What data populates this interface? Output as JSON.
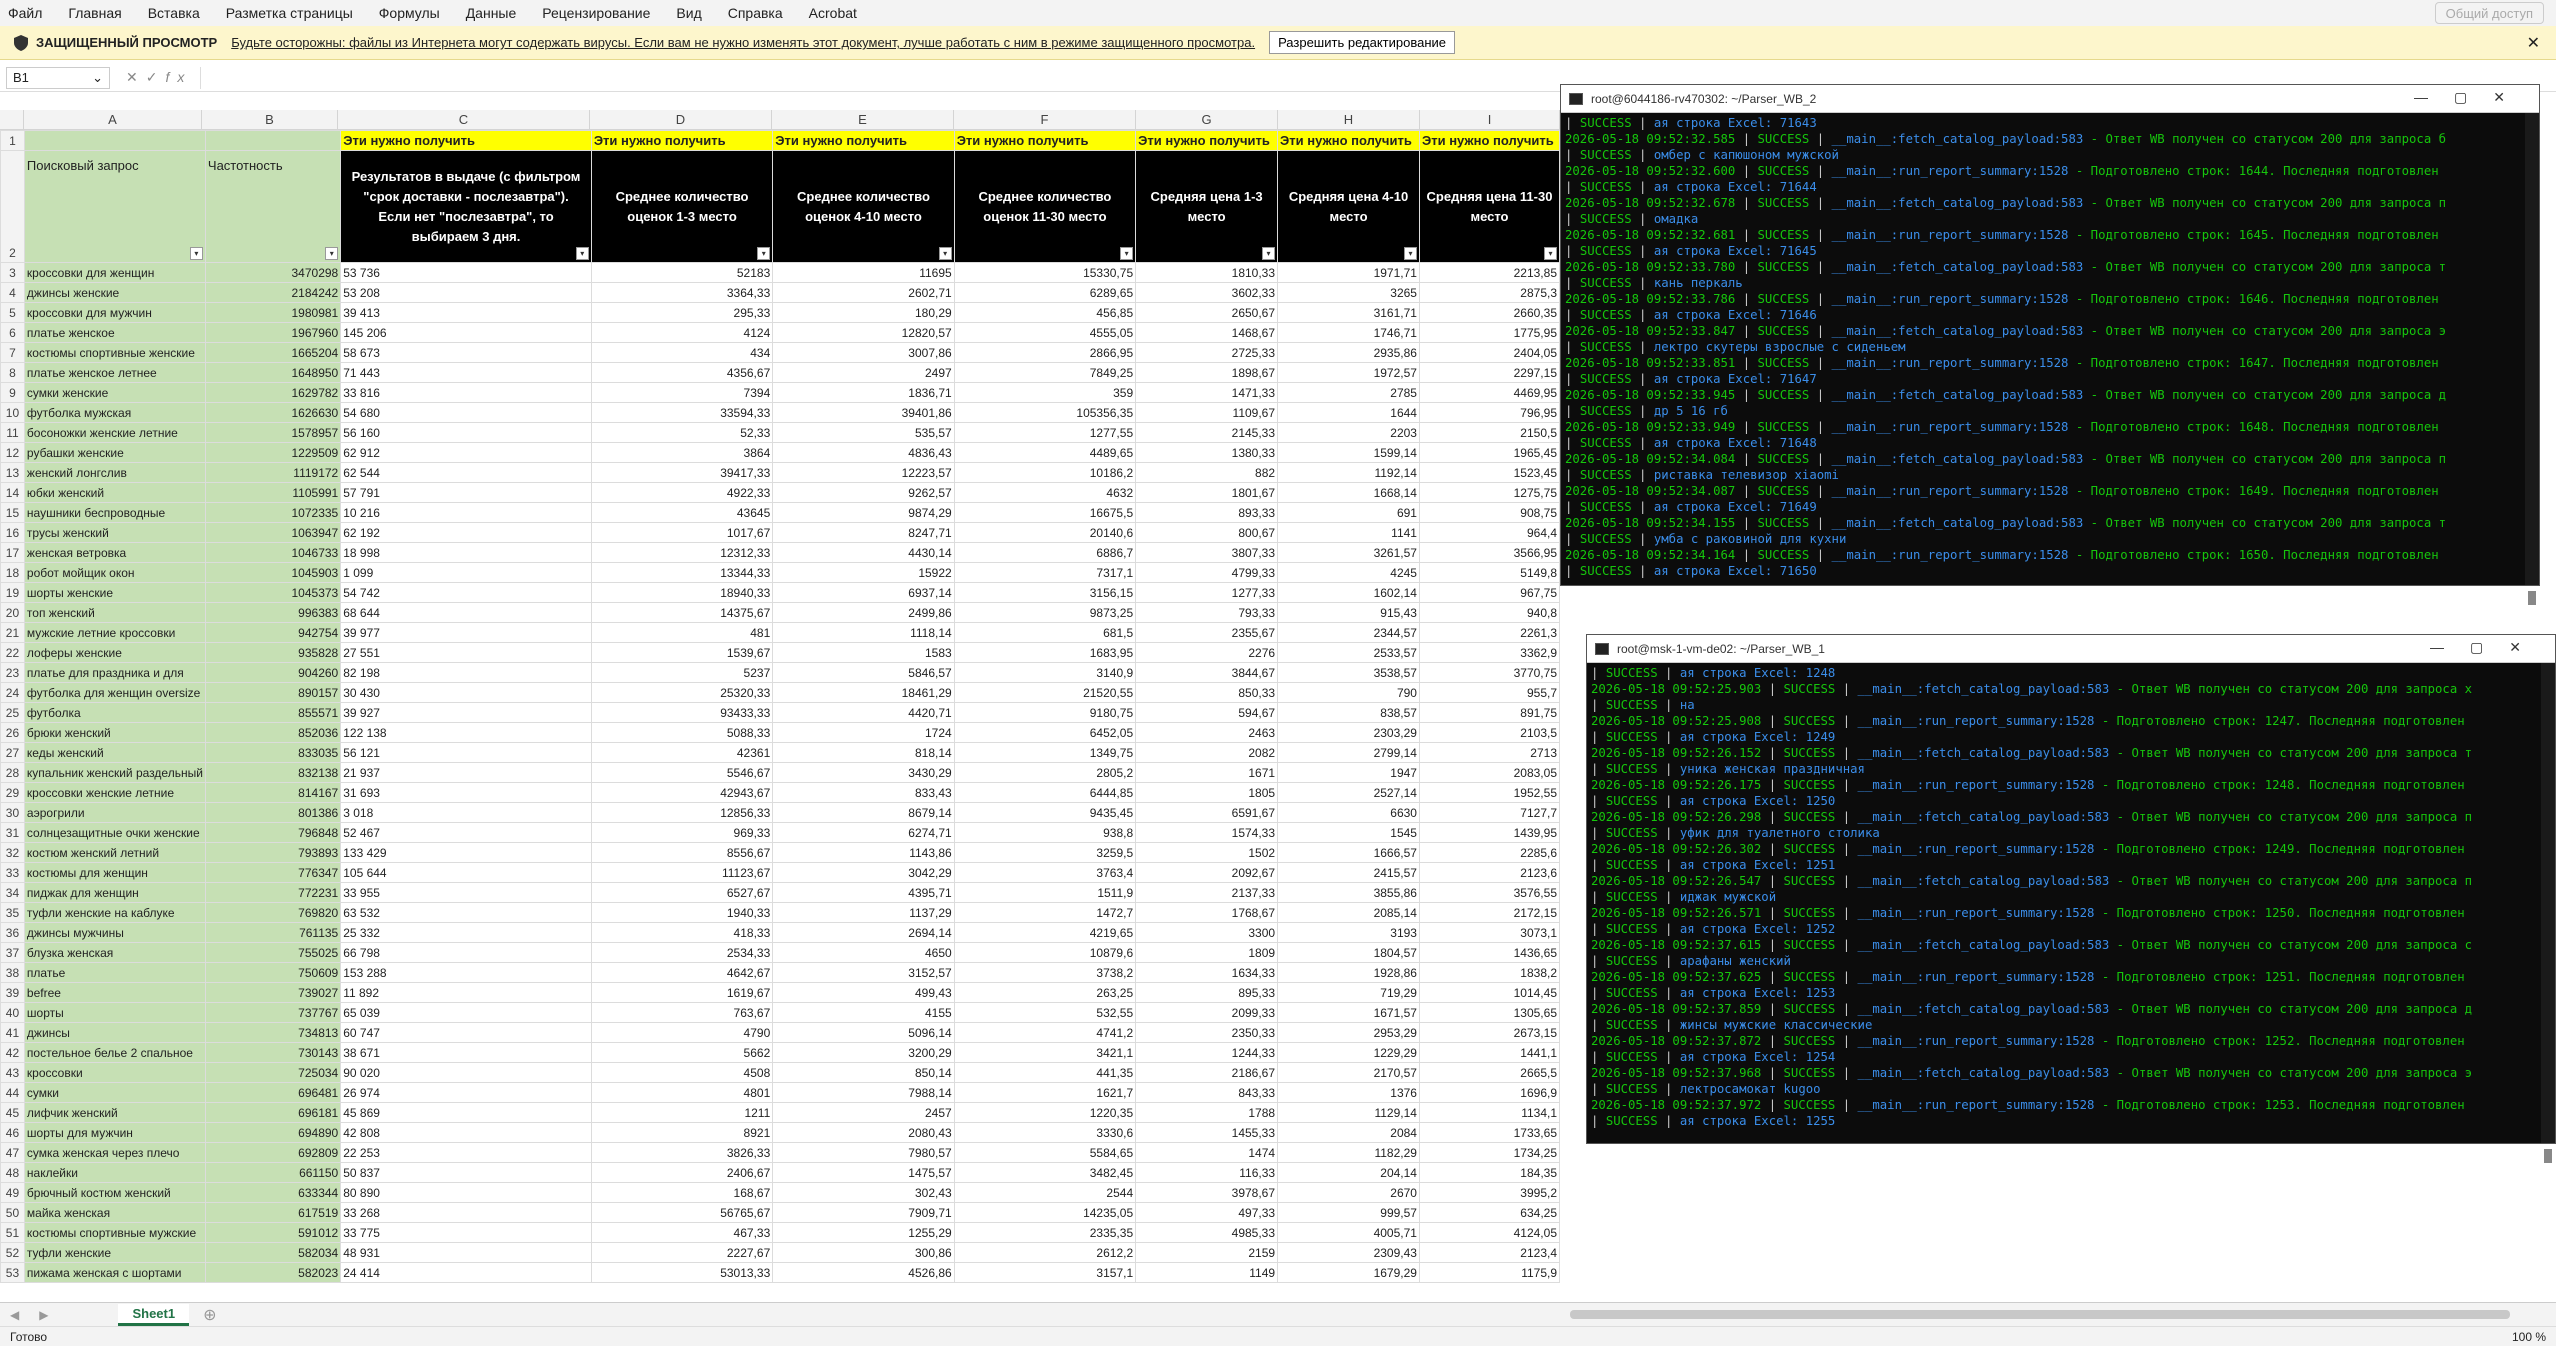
{
  "menu": [
    "Файл",
    "Главная",
    "Вставка",
    "Разметка страницы",
    "Формулы",
    "Данные",
    "Рецензирование",
    "Вид",
    "Справка",
    "Acrobat"
  ],
  "share": "Общий доступ",
  "protected": {
    "title": "ЗАЩИЩЕННЫЙ ПРОСМОТР",
    "message": "Будьте осторожны: файлы из Интернета могут содержать вирусы. Если вам не нужно изменять этот документ, лучше работать с ним в режиме защищенного просмотра.",
    "button": "Разрешить редактирование"
  },
  "formula": {
    "cell": "B1",
    "fx": "fx",
    "value": ""
  },
  "columns": [
    "A",
    "B",
    "C",
    "D",
    "E",
    "F",
    "G",
    "H",
    "I"
  ],
  "row1": [
    "",
    "",
    "Эти нужно получить",
    "Эти нужно получить",
    "Эти нужно получить",
    "Эти нужно получить",
    "Эти нужно получить",
    "Эти нужно получить",
    "Эти нужно получить"
  ],
  "headers": [
    "Поисковый запрос",
    "Частотность",
    "Результатов в выдаче (с фильтром \"срок доставки - послезавтра\"). Если нет \"послезавтра\", то выбираем 3 дня.",
    "Среднее количество оценок 1-3 место",
    "Среднее количество оценок 4-10 место",
    "Среднее количество оценок 11-30 место",
    "Средняя цена 1-3 место",
    "Средняя цена 4-10 место",
    "Средняя цена 11-30 место"
  ],
  "rows": [
    [
      "3",
      "кроссовки для женщин",
      "3470298",
      "53 736",
      "52183",
      "11695",
      "15330,75",
      "1810,33",
      "1971,71",
      "2213,85"
    ],
    [
      "4",
      "джинсы женские",
      "2184242",
      "53 208",
      "3364,33",
      "2602,71",
      "6289,65",
      "3602,33",
      "3265",
      "2875,3"
    ],
    [
      "5",
      "кроссовки для мужчин",
      "1980981",
      "39 413",
      "295,33",
      "180,29",
      "456,85",
      "2650,67",
      "3161,71",
      "2660,35"
    ],
    [
      "6",
      "платье женское",
      "1967960",
      "145 206",
      "4124",
      "12820,57",
      "4555,05",
      "1468,67",
      "1746,71",
      "1775,95"
    ],
    [
      "7",
      "костюмы спортивные женские",
      "1665204",
      "58 673",
      "434",
      "3007,86",
      "2866,95",
      "2725,33",
      "2935,86",
      "2404,05"
    ],
    [
      "8",
      "платье женское летнее",
      "1648950",
      "71 443",
      "4356,67",
      "2497",
      "7849,25",
      "1898,67",
      "1972,57",
      "2297,15"
    ],
    [
      "9",
      "сумки женские",
      "1629782",
      "33 816",
      "7394",
      "1836,71",
      "359",
      "1471,33",
      "2785",
      "4469,95"
    ],
    [
      "10",
      "футболка мужская",
      "1626630",
      "54 680",
      "33594,33",
      "39401,86",
      "105356,35",
      "1109,67",
      "1644",
      "796,95"
    ],
    [
      "11",
      "босоножки женские летние",
      "1578957",
      "56 160",
      "52,33",
      "535,57",
      "1277,55",
      "2145,33",
      "2203",
      "2150,5"
    ],
    [
      "12",
      "рубашки женские",
      "1229509",
      "62 912",
      "3864",
      "4836,43",
      "4489,65",
      "1380,33",
      "1599,14",
      "1965,45"
    ],
    [
      "13",
      "женский лонгслив",
      "1119172",
      "62 544",
      "39417,33",
      "12223,57",
      "10186,2",
      "882",
      "1192,14",
      "1523,45"
    ],
    [
      "14",
      "юбки женский",
      "1105991",
      "57 791",
      "4922,33",
      "9262,57",
      "4632",
      "1801,67",
      "1668,14",
      "1275,75"
    ],
    [
      "15",
      "наушники беспроводные",
      "1072335",
      "10 216",
      "43645",
      "9874,29",
      "16675,5",
      "893,33",
      "691",
      "908,75"
    ],
    [
      "16",
      "трусы женский",
      "1063947",
      "62 192",
      "1017,67",
      "8247,71",
      "20140,6",
      "800,67",
      "1141",
      "964,4"
    ],
    [
      "17",
      "женская ветровка",
      "1046733",
      "18 998",
      "12312,33",
      "4430,14",
      "6886,7",
      "3807,33",
      "3261,57",
      "3566,95"
    ],
    [
      "18",
      "робот мойщик окон",
      "1045903",
      "1 099",
      "13344,33",
      "15922",
      "7317,1",
      "4799,33",
      "4245",
      "5149,8"
    ],
    [
      "19",
      "шорты женские",
      "1045373",
      "54 742",
      "18940,33",
      "6937,14",
      "3156,15",
      "1277,33",
      "1602,14",
      "967,75"
    ],
    [
      "20",
      "топ женский",
      "996383",
      "68 644",
      "14375,67",
      "2499,86",
      "9873,25",
      "793,33",
      "915,43",
      "940,8"
    ],
    [
      "21",
      "мужские летние кроссовки",
      "942754",
      "39 977",
      "481",
      "1118,14",
      "681,5",
      "2355,67",
      "2344,57",
      "2261,3"
    ],
    [
      "22",
      "лоферы женские",
      "935828",
      "27 551",
      "1539,67",
      "1583",
      "1683,95",
      "2276",
      "2533,57",
      "3362,9"
    ],
    [
      "23",
      "платье для праздника и для",
      "904260",
      "82 198",
      "5237",
      "5846,57",
      "3140,9",
      "3844,67",
      "3538,57",
      "3770,75"
    ],
    [
      "24",
      "футболка для женщин oversize",
      "890157",
      "30 430",
      "25320,33",
      "18461,29",
      "21520,55",
      "850,33",
      "790",
      "955,7"
    ],
    [
      "25",
      "футболка",
      "855571",
      "39 927",
      "93433,33",
      "4420,71",
      "9180,75",
      "594,67",
      "838,57",
      "891,75"
    ],
    [
      "26",
      "брюки женский",
      "852036",
      "122 138",
      "5088,33",
      "1724",
      "6452,05",
      "2463",
      "2303,29",
      "2103,5"
    ],
    [
      "27",
      "кеды женский",
      "833035",
      "56 121",
      "42361",
      "818,14",
      "1349,75",
      "2082",
      "2799,14",
      "2713"
    ],
    [
      "28",
      "купальник женский раздельный",
      "832138",
      "21 937",
      "5546,67",
      "3430,29",
      "2805,2",
      "1671",
      "1947",
      "2083,05"
    ],
    [
      "29",
      "кроссовки женские летние",
      "814167",
      "31 693",
      "42943,67",
      "833,43",
      "6444,85",
      "1805",
      "2527,14",
      "1952,55"
    ],
    [
      "30",
      "аэрогрили",
      "801386",
      "3 018",
      "12856,33",
      "8679,14",
      "9435,45",
      "6591,67",
      "6630",
      "7127,7"
    ],
    [
      "31",
      "солнцезащитные очки женские",
      "796848",
      "52 467",
      "969,33",
      "6274,71",
      "938,8",
      "1574,33",
      "1545",
      "1439,95"
    ],
    [
      "32",
      "костюм женский летний",
      "793893",
      "133 429",
      "8556,67",
      "1143,86",
      "3259,5",
      "1502",
      "1666,57",
      "2285,6"
    ],
    [
      "33",
      "костюмы для женщин",
      "776347",
      "105 644",
      "11123,67",
      "3042,29",
      "3763,4",
      "2092,67",
      "2415,57",
      "2123,6"
    ],
    [
      "34",
      "пиджак для женщин",
      "772231",
      "33 955",
      "6527,67",
      "4395,71",
      "1511,9",
      "2137,33",
      "3855,86",
      "3576,55"
    ],
    [
      "35",
      "туфли женские на каблуке",
      "769820",
      "63 532",
      "1940,33",
      "1137,29",
      "1472,7",
      "1768,67",
      "2085,14",
      "2172,15"
    ],
    [
      "36",
      "джинсы мужчины",
      "761135",
      "25 332",
      "418,33",
      "2694,14",
      "4219,65",
      "3300",
      "3193",
      "3073,1"
    ],
    [
      "37",
      "блузка женская",
      "755025",
      "66 798",
      "2534,33",
      "4650",
      "10879,6",
      "1809",
      "1804,57",
      "1436,65"
    ],
    [
      "38",
      "платье",
      "750609",
      "153 288",
      "4642,67",
      "3152,57",
      "3738,2",
      "1634,33",
      "1928,86",
      "1838,2"
    ],
    [
      "39",
      "befree",
      "739027",
      "11 892",
      "1619,67",
      "499,43",
      "263,25",
      "895,33",
      "719,29",
      "1014,45"
    ],
    [
      "40",
      "шорты",
      "737767",
      "65 039",
      "763,67",
      "4155",
      "532,55",
      "2099,33",
      "1671,57",
      "1305,65"
    ],
    [
      "41",
      "джинсы",
      "734813",
      "60 747",
      "4790",
      "5096,14",
      "4741,2",
      "2350,33",
      "2953,29",
      "2673,15"
    ],
    [
      "42",
      "постельное белье 2 спальное",
      "730143",
      "38 671",
      "5662",
      "3200,29",
      "3421,1",
      "1244,33",
      "1229,29",
      "1441,1"
    ],
    [
      "43",
      "кроссовки",
      "725034",
      "90 020",
      "4508",
      "850,14",
      "441,35",
      "2186,67",
      "2170,57",
      "2665,5"
    ],
    [
      "44",
      "сумки",
      "696481",
      "26 974",
      "4801",
      "7988,14",
      "1621,7",
      "843,33",
      "1376",
      "1696,9"
    ],
    [
      "45",
      "лифчик женский",
      "696181",
      "45 869",
      "1211",
      "2457",
      "1220,35",
      "1788",
      "1129,14",
      "1134,1"
    ],
    [
      "46",
      "шорты для мужчин",
      "694890",
      "42 808",
      "8921",
      "2080,43",
      "3330,6",
      "1455,33",
      "2084",
      "1733,65"
    ],
    [
      "47",
      "сумка женская через плечо",
      "692809",
      "22 253",
      "3826,33",
      "7980,57",
      "5584,65",
      "1474",
      "1182,29",
      "1734,25"
    ],
    [
      "48",
      "наклейки",
      "661150",
      "50 837",
      "2406,67",
      "1475,57",
      "3482,45",
      "116,33",
      "204,14",
      "184,35"
    ],
    [
      "49",
      "брючный костюм женский",
      "633344",
      "80 890",
      "168,67",
      "302,43",
      "2544",
      "3978,67",
      "2670",
      "3995,2"
    ],
    [
      "50",
      "майка женская",
      "617519",
      "33 268",
      "56765,67",
      "7909,71",
      "14235,05",
      "497,33",
      "999,57",
      "634,25"
    ],
    [
      "51",
      "костюмы спортивные мужские",
      "591012",
      "33 775",
      "467,33",
      "1255,29",
      "2335,35",
      "4985,33",
      "4005,71",
      "4124,05"
    ],
    [
      "52",
      "туфли женские",
      "582034",
      "48 931",
      "2227,67",
      "300,86",
      "2612,2",
      "2159",
      "2309,43",
      "2123,4"
    ],
    [
      "53",
      "пижама женская с шортами",
      "582023",
      "24 414",
      "53013,33",
      "4526,86",
      "3157,1",
      "1149",
      "1679,29",
      "1175,9"
    ]
  ],
  "sheet_tab": "Sheet1",
  "status_text": "Готово",
  "zoom": "100 %",
  "term1": {
    "title": "root@6044186-rv470302: ~/Parser_WB_2",
    "lines": [
      [
        "",
        "ая строка Excel: 71643"
      ],
      [
        "2026-05-18 09:52:32.585 ",
        "__main__:fetch_catalog_payload:583",
        " - Ответ WB получен со статусом 200 для запроса б"
      ],
      [
        "",
        "омбер с капюшоном мужской"
      ],
      [
        "2026-05-18 09:52:32.600 ",
        "__main__:run_report_summary:1528",
        " - Подготовлено строк: 1644. Последняя подготовлен"
      ],
      [
        "",
        "ая строка Excel: 71644"
      ],
      [
        "2026-05-18 09:52:32.678 ",
        "__main__:fetch_catalog_payload:583",
        " - Ответ WB получен со статусом 200 для запроса п"
      ],
      [
        "",
        "омадка"
      ],
      [
        "2026-05-18 09:52:32.681 ",
        "__main__:run_report_summary:1528",
        " - Подготовлено строк: 1645. Последняя подготовлен"
      ],
      [
        "",
        "ая строка Excel: 71645"
      ],
      [
        "2026-05-18 09:52:33.780 ",
        "__main__:fetch_catalog_payload:583",
        " - Ответ WB получен со статусом 200 для запроса т"
      ],
      [
        "",
        "кань перкаль"
      ],
      [
        "2026-05-18 09:52:33.786 ",
        "__main__:run_report_summary:1528",
        " - Подготовлено строк: 1646. Последняя подготовлен"
      ],
      [
        "",
        "ая строка Excel: 71646"
      ],
      [
        "2026-05-18 09:52:33.847 ",
        "__main__:fetch_catalog_payload:583",
        " - Ответ WB получен со статусом 200 для запроса э"
      ],
      [
        "",
        "лектро скутеры взрослые с сиденьем"
      ],
      [
        "2026-05-18 09:52:33.851 ",
        "__main__:run_report_summary:1528",
        " - Подготовлено строк: 1647. Последняя подготовлен"
      ],
      [
        "",
        "ая строка Excel: 71647"
      ],
      [
        "2026-05-18 09:52:33.945 ",
        "__main__:fetch_catalog_payload:583",
        " - Ответ WB получен со статусом 200 для запроса д"
      ],
      [
        "",
        "др 5 16 гб"
      ],
      [
        "2026-05-18 09:52:33.949 ",
        "__main__:run_report_summary:1528",
        " - Подготовлено строк: 1648. Последняя подготовлен"
      ],
      [
        "",
        "ая строка Excel: 71648"
      ],
      [
        "2026-05-18 09:52:34.084 ",
        "__main__:fetch_catalog_payload:583",
        " - Ответ WB получен со статусом 200 для запроса п"
      ],
      [
        "",
        "риставка телевизор xiaomi"
      ],
      [
        "2026-05-18 09:52:34.087 ",
        "__main__:run_report_summary:1528",
        " - Подготовлено строк: 1649. Последняя подготовлен"
      ],
      [
        "",
        "ая строка Excel: 71649"
      ],
      [
        "2026-05-18 09:52:34.155 ",
        "__main__:fetch_catalog_payload:583",
        " - Ответ WB получен со статусом 200 для запроса т"
      ],
      [
        "",
        "умба с раковиной для кухни"
      ],
      [
        "2026-05-18 09:52:34.164 ",
        "__main__:run_report_summary:1528",
        " - Подготовлено строк: 1650. Последняя подготовлен"
      ],
      [
        "",
        "ая строка Excel: 71650"
      ]
    ]
  },
  "term2": {
    "title": "root@msk-1-vm-de02: ~/Parser_WB_1",
    "lines": [
      [
        "",
        "ая строка Excel: 1248"
      ],
      [
        "2026-05-18 09:52:25.903 ",
        "__main__:fetch_catalog_payload:583",
        " - Ответ WB получен со статусом 200 для запроса х"
      ],
      [
        "",
        "на"
      ],
      [
        "2026-05-18 09:52:25.908 ",
        "__main__:run_report_summary:1528",
        " - Подготовлено строк: 1247. Последняя подготовлен"
      ],
      [
        "",
        "ая строка Excel: 1249"
      ],
      [
        "2026-05-18 09:52:26.152 ",
        "__main__:fetch_catalog_payload:583",
        " - Ответ WB получен со статусом 200 для запроса т"
      ],
      [
        "",
        "уника женская праздничная"
      ],
      [
        "2026-05-18 09:52:26.175 ",
        "__main__:run_report_summary:1528",
        " - Подготовлено строк: 1248. Последняя подготовлен"
      ],
      [
        "",
        "ая строка Excel: 1250"
      ],
      [
        "2026-05-18 09:52:26.298 ",
        "__main__:fetch_catalog_payload:583",
        " - Ответ WB получен со статусом 200 для запроса п"
      ],
      [
        "",
        "уфик для туалетного столика"
      ],
      [
        "2026-05-18 09:52:26.302 ",
        "__main__:run_report_summary:1528",
        " - Подготовлено строк: 1249. Последняя подготовлен"
      ],
      [
        "",
        "ая строка Excel: 1251"
      ],
      [
        "2026-05-18 09:52:26.547 ",
        "__main__:fetch_catalog_payload:583",
        " - Ответ WB получен со статусом 200 для запроса п"
      ],
      [
        "",
        "иджак мужской"
      ],
      [
        "2026-05-18 09:52:26.571 ",
        "__main__:run_report_summary:1528",
        " - Подготовлено строк: 1250. Последняя подготовлен"
      ],
      [
        "",
        "ая строка Excel: 1252"
      ],
      [
        "2026-05-18 09:52:37.615 ",
        "__main__:fetch_catalog_payload:583",
        " - Ответ WB получен со статусом 200 для запроса с"
      ],
      [
        "",
        "арафаны женский"
      ],
      [
        "2026-05-18 09:52:37.625 ",
        "__main__:run_report_summary:1528",
        " - Подготовлено строк: 1251. Последняя подготовлен"
      ],
      [
        "",
        "ая строка Excel: 1253"
      ],
      [
        "2026-05-18 09:52:37.859 ",
        "__main__:fetch_catalog_payload:583",
        " - Ответ WB получен со статусом 200 для запроса д"
      ],
      [
        "",
        "жинсы мужские классические"
      ],
      [
        "2026-05-18 09:52:37.872 ",
        "__main__:run_report_summary:1528",
        " - Подготовлено строк: 1252. Последняя подготовлен"
      ],
      [
        "",
        "ая строка Excel: 1254"
      ],
      [
        "2026-05-18 09:52:37.968 ",
        "__main__:fetch_catalog_payload:583",
        " - Ответ WB получен со статусом 200 для запроса э"
      ],
      [
        "",
        "лектросамокат kugoo"
      ],
      [
        "2026-05-18 09:52:37.972 ",
        "__main__:run_report_summary:1528",
        " - Подготовлено строк: 1253. Последняя подготовлен"
      ],
      [
        "",
        "ая строка Excel: 1255"
      ]
    ]
  },
  "log_level": "SUCCESS"
}
